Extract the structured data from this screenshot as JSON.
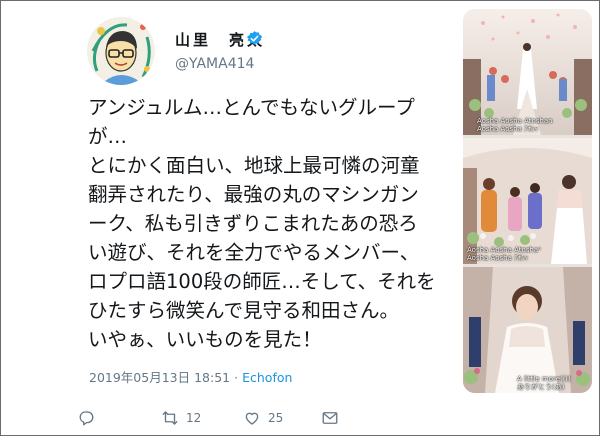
{
  "colors": {
    "accent": "#1b95e0",
    "muted": "#657786",
    "text": "#14171a",
    "border": "#6b6b6b"
  },
  "user": {
    "display_name": "山里　亮太",
    "handle": "@YAMA414",
    "verified": true,
    "avatar_icon": "cartoon-portrait-avatar"
  },
  "tweet": {
    "lines": [
      "アンジュルム…とんでもないグループ",
      "が…",
      "とにかく面白い、地球上最可憐の河童",
      "翻弄されたり、最強の丸のマシンガン",
      "ーク、私も引きずりこまれたあの恐ろ",
      "い遊び、それを全力でやるメンバー、",
      "ロプロ語100段の師匠…そして、それを",
      "ひたすら微笑んで見守る和田さん。",
      "いやぁ、いいものを見た！"
    ],
    "date": "2019年05月13日 18:51",
    "separator": "·",
    "source": "Echofon"
  },
  "actions": {
    "reply_icon": "reply-icon",
    "retweet_icon": "retweet-icon",
    "retweet_count": "12",
    "like_icon": "heart-icon",
    "like_count": "25",
    "share_icon": "mail-icon"
  },
  "photos": {
    "photo1_caption": [
      "Aosha Aosha Atoshan",
      "Aosha Aosha ｱｵｼｬ"
    ],
    "photo2_caption": [
      "Aosha Aosha Atoshaᵃ",
      "Aosha Aosha ｱｵｼｬ"
    ],
    "photo3_caption": [
      "A little more((((",
      "ありがとう(あ)"
    ]
  }
}
